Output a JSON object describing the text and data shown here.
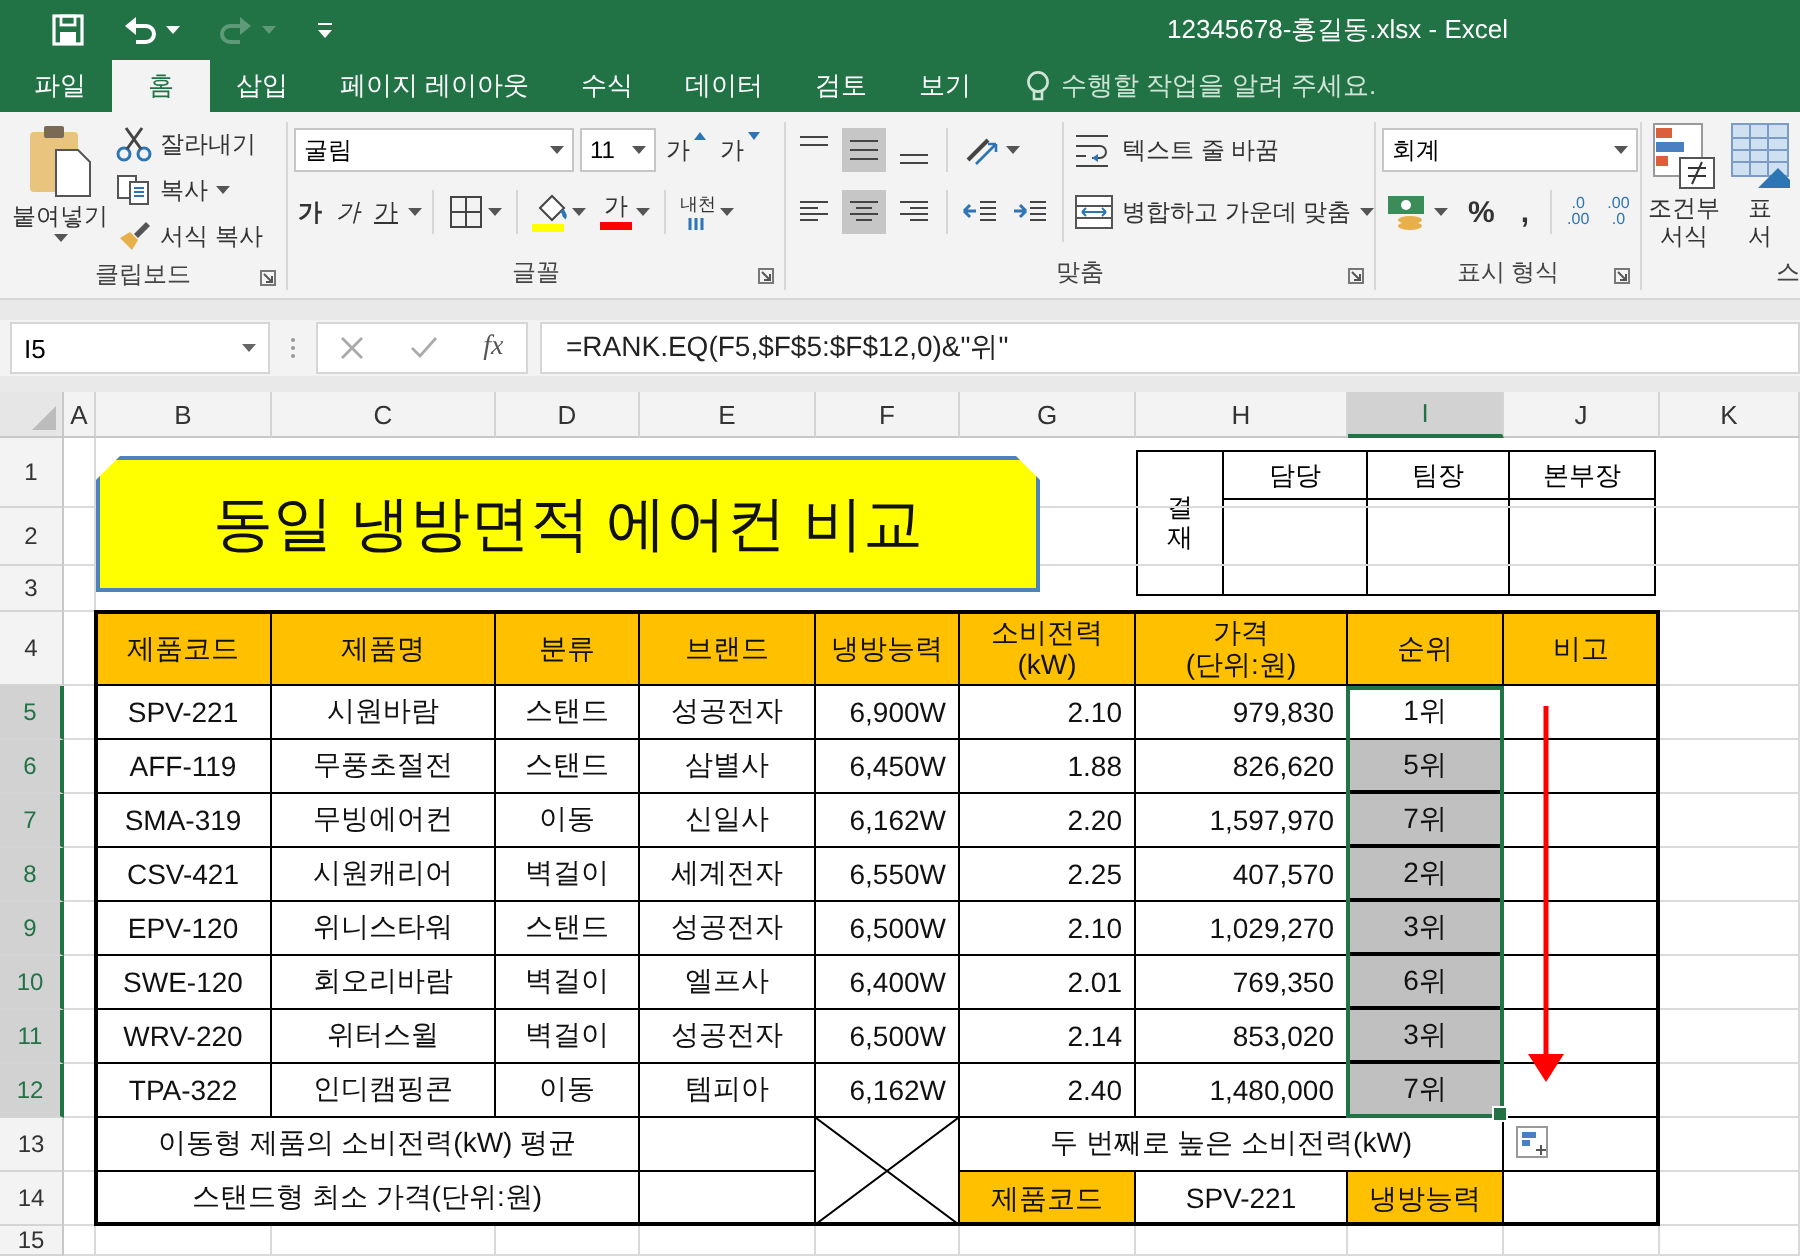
{
  "title_bar": {
    "title": "12345678-홍길동.xlsx - Excel",
    "quick_access": [
      {
        "kind": "save",
        "disabled": false
      },
      {
        "kind": "undo",
        "disabled": false
      },
      {
        "kind": "redo",
        "disabled": true
      },
      {
        "kind": "customize",
        "disabled": false
      }
    ]
  },
  "ribbon": {
    "tabs": [
      {
        "label": "파일",
        "selected": false
      },
      {
        "label": "홈",
        "selected": true
      },
      {
        "label": "삽입",
        "selected": false
      },
      {
        "label": "페이지 레이아웃",
        "selected": false
      },
      {
        "label": "수식",
        "selected": false
      },
      {
        "label": "데이터",
        "selected": false
      },
      {
        "label": "검토",
        "selected": false
      },
      {
        "label": "보기",
        "selected": false
      }
    ],
    "tell_me": {
      "placeholder": "수행할 작업을 알려 주세요."
    },
    "clipboard": {
      "paste": "붙여넣기",
      "cut": "잘라내기",
      "copy": "복사",
      "format_painter": "서식 복사",
      "label": "클립보드"
    },
    "font": {
      "name": "굴림",
      "size": "11",
      "grow": "가",
      "shrink": "가",
      "bold": "가",
      "italic": "가",
      "underline": "가",
      "font_color": "가",
      "phonetic": "내천",
      "label": "글꼴"
    },
    "alignment": {
      "vertical": [
        {
          "selected": false
        },
        {
          "selected": true
        },
        {
          "selected": false
        }
      ],
      "horizontal": [
        {
          "selected": false
        },
        {
          "selected": true
        },
        {
          "selected": false
        }
      ],
      "wrap_text": "텍스트 줄 바꿈",
      "merge": "병합하고 가운데 맞춤",
      "label": "맞춤"
    },
    "number": {
      "format": "회계",
      "percent": "%",
      "comma": ",",
      "increase_decimal": ".0\n.00",
      "decrease_decimal": ".00\n.0",
      "label": "표시 형식"
    },
    "styles": {
      "conditional": "조건부\n서식",
      "table": "표\n서",
      "label": "스"
    }
  },
  "formula_bar": {
    "name_box": "I5",
    "fx": "fx",
    "formula": "=RANK.EQ(F5,$F$5:$F$12,0)&\"위\""
  },
  "sheet": {
    "columns": [
      {
        "label": "A",
        "selected": false
      },
      {
        "label": "B",
        "selected": false
      },
      {
        "label": "C",
        "selected": false
      },
      {
        "label": "D",
        "selected": false
      },
      {
        "label": "E",
        "selected": false
      },
      {
        "label": "F",
        "selected": false
      },
      {
        "label": "G",
        "selected": false
      },
      {
        "label": "H",
        "selected": false
      },
      {
        "label": "I",
        "selected": true
      },
      {
        "label": "J",
        "selected": false
      },
      {
        "label": "K",
        "selected": false
      }
    ],
    "rows": [
      {
        "label": "1",
        "selected": false
      },
      {
        "label": "2",
        "selected": false
      },
      {
        "label": "3",
        "selected": false
      },
      {
        "label": "4",
        "selected": false
      },
      {
        "label": "5",
        "selected": true
      },
      {
        "label": "6",
        "selected": true
      },
      {
        "label": "7",
        "selected": true
      },
      {
        "label": "8",
        "selected": true
      },
      {
        "label": "9",
        "selected": true
      },
      {
        "label": "10",
        "selected": true
      },
      {
        "label": "11",
        "selected": true
      },
      {
        "label": "12",
        "selected": true
      },
      {
        "label": "13",
        "selected": false
      },
      {
        "label": "14",
        "selected": false
      },
      {
        "label": "15",
        "selected": false
      }
    ],
    "title": "동일 냉방면적 에어컨 비교",
    "approval": {
      "label": "결재",
      "roles": [
        "담당",
        "팀장",
        "본부장"
      ]
    },
    "table": {
      "columns": [
        "제품코드",
        "제품명",
        "분류",
        "브랜드",
        "냉방능력",
        "소비전력\n(kW)",
        "가격\n(단위:원)",
        "순위",
        "비고"
      ],
      "rows": [
        {
          "cells": [
            "SPV-221",
            "시원바람",
            "스탠드",
            "성공전자",
            "6,900W",
            "2.10",
            "979,830",
            "1위"
          ],
          "selected": true,
          "active": true
        },
        {
          "cells": [
            "AFF-119",
            "무풍초절전",
            "스탠드",
            "삼별사",
            "6,450W",
            "1.88",
            "826,620",
            "5위"
          ],
          "selected": true,
          "active": false
        },
        {
          "cells": [
            "SMA-319",
            "무빙에어컨",
            "이동",
            "신일사",
            "6,162W",
            "2.20",
            "1,597,970",
            "7위"
          ],
          "selected": true,
          "active": false
        },
        {
          "cells": [
            "CSV-421",
            "시원캐리어",
            "벽걸이",
            "세계전자",
            "6,550W",
            "2.25",
            "407,570",
            "2위"
          ],
          "selected": true,
          "active": false
        },
        {
          "cells": [
            "EPV-120",
            "위니스타워",
            "스탠드",
            "성공전자",
            "6,500W",
            "2.10",
            "1,029,270",
            "3위"
          ],
          "selected": true,
          "active": false
        },
        {
          "cells": [
            "SWE-120",
            "회오리바람",
            "벽걸이",
            "엘프사",
            "6,400W",
            "2.01",
            "769,350",
            "6위"
          ],
          "selected": true,
          "active": false
        },
        {
          "cells": [
            "WRV-220",
            "위터스윌",
            "벽걸이",
            "성공전자",
            "6,500W",
            "2.14",
            "853,020",
            "3위"
          ],
          "selected": true,
          "active": false
        },
        {
          "cells": [
            "TPA-322",
            "인디캠핑콘",
            "이동",
            "템피아",
            "6,162W",
            "2.40",
            "1,480,000",
            "7위"
          ],
          "selected": true,
          "active": false
        }
      ]
    },
    "summary": [
      "이동형 제품의 소비전력(kW) 평균",
      "스탠드형 최소 가격(단위:원)"
    ],
    "second_highest": {
      "label": "두 번째로 높은 소비전력(kW)",
      "headers": [
        "제품코드",
        "냉방능력"
      ],
      "value": "SPV-221"
    }
  }
}
